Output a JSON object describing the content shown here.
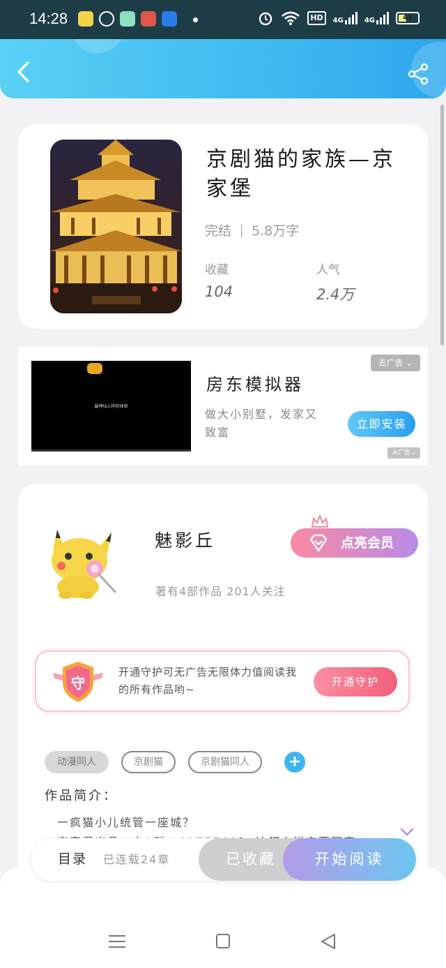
{
  "status_bar": {
    "time": "14:28",
    "app_icons": [
      "wechat-work-icon",
      "wechat-icon",
      "app-icon",
      "app-icon",
      "alipay-icon"
    ],
    "app_colors": [
      "#f5d24b",
      "#ffffff",
      "#8de0c0",
      "#e0564a",
      "#2b7bea"
    ],
    "network_hd": "HD",
    "signal_1": "4G",
    "signal_2": "4G",
    "battery": "41",
    "battery_level": 0.41
  },
  "header": {
    "back_icon": "chevron-left-icon",
    "share_icon": "share-icon"
  },
  "book": {
    "title": "京剧猫的家族—京家堡",
    "status": "完结",
    "word_count": "5.8万字",
    "favorites_label": "收藏",
    "favorites_value": "104",
    "popularity_label": "人气",
    "popularity_value": "2.4万"
  },
  "ad": {
    "video_text": "最神仙么样的体验",
    "title": "房东模拟器",
    "description": "做大小别墅，发家又致富",
    "install_label": "立即安装",
    "remove_ad_label": "去广告",
    "ad_tag": "广告"
  },
  "author": {
    "name": "魅影丘",
    "meta": "著有4部作品 201人关注",
    "vip_label": "点亮会员",
    "guard_shield_char": "守",
    "guard_text": "开通守护可无广告无限体力值阅读我的所有作品哟~",
    "guard_button": "开通守护",
    "tags": [
      "动漫同人",
      "京剧猫",
      "京剧猫同人"
    ],
    "tag_add": "+",
    "intro_heading": "作品简介：",
    "intro_line1": "一疯猫小儿统管一座城？",
    "intro_line2": "京家堡出品，白0群：6177740f，这都上说亲要写字"
  },
  "bottom_bar": {
    "toc_label": "目录",
    "serial_label": "已连载24章",
    "collected_label": "已收藏",
    "read_label": "开始阅读"
  },
  "nav": {
    "menu_icon": "menu-icon",
    "home_icon": "square-home-icon",
    "back_icon": "triangle-back-icon"
  }
}
